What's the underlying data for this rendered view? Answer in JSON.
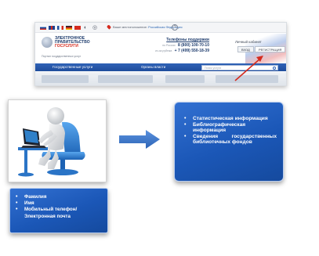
{
  "portal": {
    "location_prefix": "Ваше местоположение:",
    "location_value": "Российская Федерация",
    "logo_line1": "ЭЛЕКТРОННОЕ",
    "logo_line2": "ПРАВИТЕЛЬСТВО",
    "logo_line3": "ГОСУСЛУГИ",
    "tagline": "Портал государственных услуг",
    "support_title": "Телефоны поддержки",
    "support_free_label": "по России",
    "support_free_number": "8 (800) 100-70-10",
    "support_paid_label": "из-за рубежа",
    "support_paid_number": "+ 7 (499) 550-18-39",
    "cabinet_title": "Личный кабинет",
    "login_label": "ВХОД",
    "register_label": "РЕГИСТРАЦИЯ",
    "nav_services": "Государственные услуги",
    "nav_authorities": "Органы власти",
    "search_placeholder": "Поиск услуги"
  },
  "info_box": {
    "items": [
      "Статистическая информация",
      "Библиографическая информация",
      "Сведения государственных библиотечных фондов"
    ]
  },
  "user_box": {
    "items": [
      "Фамилия",
      "Имя",
      "Мобильный телефон/Электронная почта"
    ]
  },
  "colors": {
    "box_blue": "#1b57b7",
    "arrow_blue": "#3a73c4",
    "accent_red": "#d52b1e",
    "figure_chair": "#2f7fd0"
  }
}
